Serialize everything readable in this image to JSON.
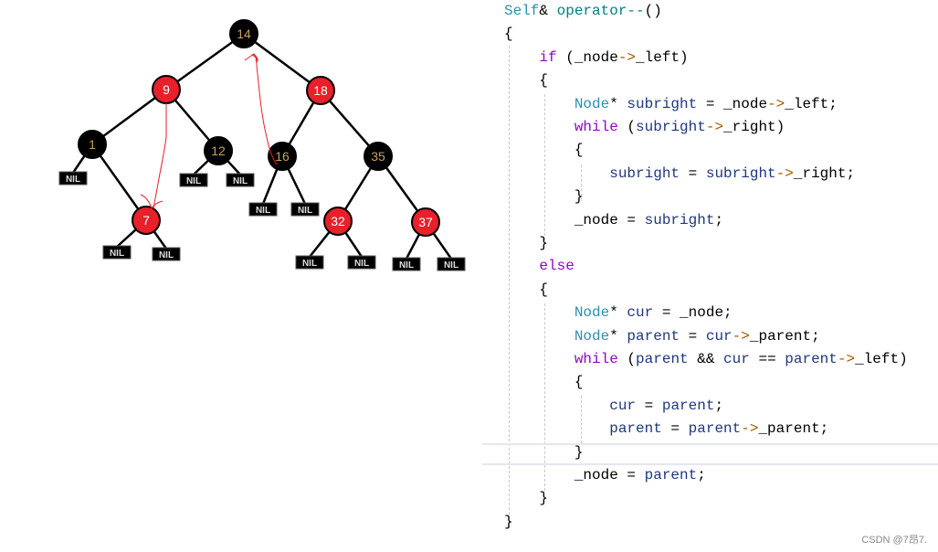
{
  "tree": {
    "colors": {
      "red": "#e8202a",
      "black": "#000000",
      "annotation": "#e8202a"
    },
    "nodes": [
      {
        "id": "14",
        "label": "14",
        "color": "black"
      },
      {
        "id": "9",
        "label": "9",
        "color": "red"
      },
      {
        "id": "18",
        "label": "18",
        "color": "red"
      },
      {
        "id": "1",
        "label": "1",
        "color": "black"
      },
      {
        "id": "12",
        "label": "12",
        "color": "black"
      },
      {
        "id": "16",
        "label": "16",
        "color": "black"
      },
      {
        "id": "35",
        "label": "35",
        "color": "black"
      },
      {
        "id": "7",
        "label": "7",
        "color": "red"
      },
      {
        "id": "32",
        "label": "32",
        "color": "red"
      },
      {
        "id": "37",
        "label": "37",
        "color": "red"
      }
    ],
    "edges": [
      [
        "14",
        "9"
      ],
      [
        "14",
        "18"
      ],
      [
        "9",
        "1"
      ],
      [
        "9",
        "12"
      ],
      [
        "18",
        "16"
      ],
      [
        "18",
        "35"
      ],
      [
        "1",
        "7"
      ],
      [
        "35",
        "32"
      ],
      [
        "35",
        "37"
      ]
    ],
    "nil_label": "NIL",
    "nil_parents": [
      "1",
      "12",
      "12",
      "7",
      "7",
      "16",
      "16",
      "32",
      "32",
      "37",
      "37"
    ],
    "annotations": [
      "arrow from 9 to 7",
      "arrow from 16 to 14"
    ]
  },
  "code": {
    "lines": [
      [
        [
          "type",
          "Self"
        ],
        [
          "p",
          "& "
        ],
        [
          "fn",
          "operator--"
        ],
        [
          "p",
          "()"
        ]
      ],
      [
        [
          "p",
          "{"
        ]
      ],
      [
        [
          "p",
          "    "
        ],
        [
          "kw",
          "if"
        ],
        [
          "p",
          " (_node"
        ],
        [
          "op",
          "->"
        ],
        [
          "mem",
          "_left"
        ],
        [
          "p",
          ")"
        ]
      ],
      [
        [
          "p",
          "    {"
        ]
      ],
      [
        [
          "p",
          "        "
        ],
        [
          "type",
          "Node"
        ],
        [
          "p",
          "* "
        ],
        [
          "var",
          "subright"
        ],
        [
          "p",
          " = _node"
        ],
        [
          "op",
          "->"
        ],
        [
          "mem",
          "_left"
        ],
        [
          "p",
          ";"
        ]
      ],
      [
        [
          "p",
          "        "
        ],
        [
          "kw",
          "while"
        ],
        [
          "p",
          " ("
        ],
        [
          "var",
          "subright"
        ],
        [
          "op",
          "->"
        ],
        [
          "mem",
          "_right"
        ],
        [
          "p",
          ")"
        ]
      ],
      [
        [
          "p",
          "        {"
        ]
      ],
      [
        [
          "p",
          "            "
        ],
        [
          "var",
          "subright"
        ],
        [
          "p",
          " = "
        ],
        [
          "var",
          "subright"
        ],
        [
          "op",
          "->"
        ],
        [
          "mem",
          "_right"
        ],
        [
          "p",
          ";"
        ]
      ],
      [
        [
          "p",
          "        }"
        ]
      ],
      [
        [
          "p",
          "        _node = "
        ],
        [
          "var",
          "subright"
        ],
        [
          "p",
          ";"
        ]
      ],
      [
        [
          "p",
          "    }"
        ]
      ],
      [
        [
          "p",
          "    "
        ],
        [
          "kw",
          "else"
        ]
      ],
      [
        [
          "p",
          "    {"
        ]
      ],
      [
        [
          "p",
          "        "
        ],
        [
          "type",
          "Node"
        ],
        [
          "p",
          "* "
        ],
        [
          "var",
          "cur"
        ],
        [
          "p",
          " = _node;"
        ]
      ],
      [
        [
          "p",
          "        "
        ],
        [
          "type",
          "Node"
        ],
        [
          "p",
          "* "
        ],
        [
          "var",
          "parent"
        ],
        [
          "p",
          " = "
        ],
        [
          "var",
          "cur"
        ],
        [
          "op",
          "->"
        ],
        [
          "mem",
          "_parent"
        ],
        [
          "p",
          ";"
        ]
      ],
      [
        [
          "p",
          "        "
        ],
        [
          "kw",
          "while"
        ],
        [
          "p",
          " ("
        ],
        [
          "var",
          "parent"
        ],
        [
          "p",
          " && "
        ],
        [
          "var",
          "cur"
        ],
        [
          "p",
          " == "
        ],
        [
          "var",
          "parent"
        ],
        [
          "op",
          "->"
        ],
        [
          "mem",
          "_left"
        ],
        [
          "p",
          ")"
        ]
      ],
      [
        [
          "p",
          "        {"
        ]
      ],
      [
        [
          "p",
          "            "
        ],
        [
          "var",
          "cur"
        ],
        [
          "p",
          " = "
        ],
        [
          "var",
          "parent"
        ],
        [
          "p",
          ";"
        ]
      ],
      [
        [
          "p",
          "            "
        ],
        [
          "var",
          "parent"
        ],
        [
          "p",
          " = "
        ],
        [
          "var",
          "parent"
        ],
        [
          "op",
          "->"
        ],
        [
          "mem",
          "_parent"
        ],
        [
          "p",
          ";"
        ]
      ],
      [
        [
          "p",
          "        }"
        ]
      ],
      [
        [
          "p",
          "        _node = "
        ],
        [
          "var",
          "parent"
        ],
        [
          "p",
          ";"
        ]
      ],
      [
        [
          "p",
          "    }"
        ]
      ],
      [
        [
          "p",
          "}"
        ]
      ]
    ]
  },
  "watermark": "CSDN @7昂7."
}
